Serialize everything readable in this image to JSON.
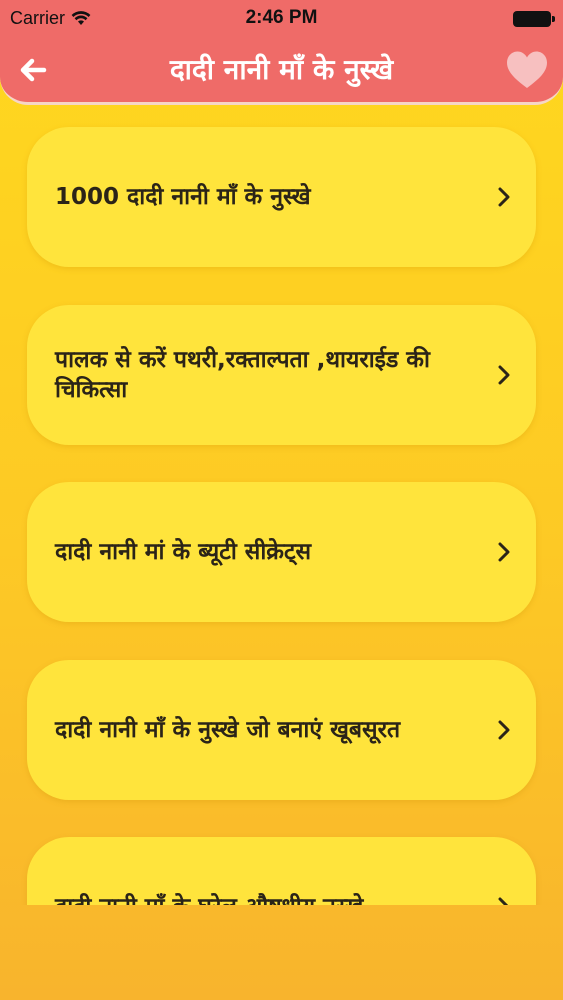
{
  "status_bar": {
    "carrier": "Carrier",
    "time": "2:46 PM"
  },
  "nav": {
    "title": "दादी नानी माँ के नुस्खे",
    "back_icon": "arrow-left-icon",
    "favorite_icon": "heart-icon"
  },
  "colors": {
    "header": "#ef6b68",
    "card": "#ffe43c",
    "background": "#fdc925",
    "text": "#2b2418"
  },
  "items": [
    {
      "label": "1000 दादी नानी माँ के नुस्खे"
    },
    {
      "label": "पालक से करें पथरी,रक्ताल्पता ,थायराईड की चिकित्सा"
    },
    {
      "label": "दादी नानी मां के ब्यूटी सीक्रेट्स"
    },
    {
      "label": "दादी नानी माँ के नुस्खे जो बनाएं खूबसूरत"
    },
    {
      "label": "दादी नानी माँ के घरेलु औषधीय नुस्खे"
    }
  ]
}
